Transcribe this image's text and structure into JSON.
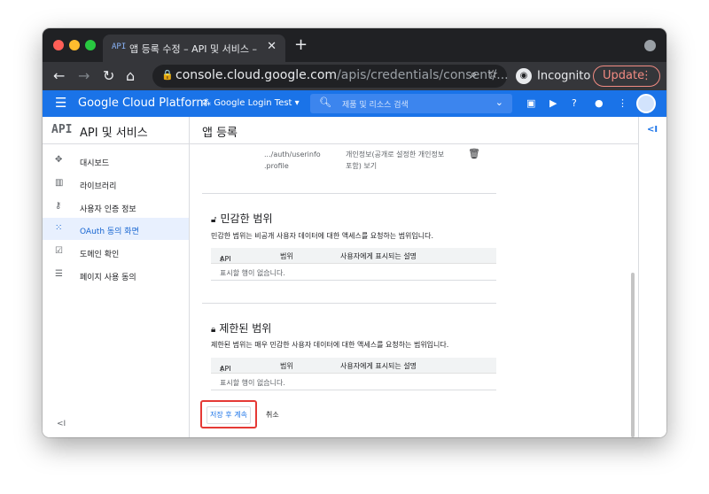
{
  "browser": {
    "tab_favicon": "API",
    "tab_title": "앱 등록 수정 – API 및 서비스 – Goo",
    "tab_close": "✕",
    "new_tab": "+",
    "url_host": "console.cloud.google.com",
    "url_path": "/apis/credentials/consent/...",
    "incognito_label": "Incognito",
    "update_label": "Update"
  },
  "gcp_header": {
    "brand": "Google Cloud Platform",
    "project": "Google Login Test",
    "search_placeholder": "제품 및 리소스 검색"
  },
  "sidebar": {
    "api_label": "API",
    "title": "API 및 서비스",
    "items": [
      {
        "label": "대시보드",
        "icon": "dashboard-icon"
      },
      {
        "label": "라이브러리",
        "icon": "library-icon"
      },
      {
        "label": "사용자 인증 정보",
        "icon": "key-icon"
      },
      {
        "label": "OAuth 동의 화면",
        "icon": "consent-icon",
        "active": true
      },
      {
        "label": "도메인 확인",
        "icon": "domain-check-icon"
      },
      {
        "label": "페이지 사용 동의",
        "icon": "page-agreement-icon"
      }
    ],
    "collapse_label": "<I"
  },
  "main": {
    "title": "앱 등록",
    "scope_row": {
      "scope": ".../auth/userinfo .profile",
      "description": "개인정보(공개로 설정한 개인정보 포함) 보기"
    },
    "sensitive": {
      "title": "민감한 범위",
      "description": "민감한 범위는 비공개 사용자 데이터에 대한 액세스를 요청하는 범위입니다.",
      "col_api": "API",
      "col_scope": "범위",
      "col_user_desc": "사용자에게 표시되는 설명",
      "empty": "표시할 행이 없습니다."
    },
    "restricted": {
      "title": "제한된 범위",
      "description": "제한된 범위는 매우 민감한 사용자 데이터에 대한 액세스를 요청하는 범위입니다.",
      "col_api": "API",
      "col_scope": "범위",
      "col_user_desc": "사용자에게 표시되는 설명",
      "empty": "표시할 행이 없습니다."
    },
    "save_button": "저장 후 계속",
    "cancel_button": "취소"
  },
  "right_rail": {
    "collapse_label": "<I"
  }
}
